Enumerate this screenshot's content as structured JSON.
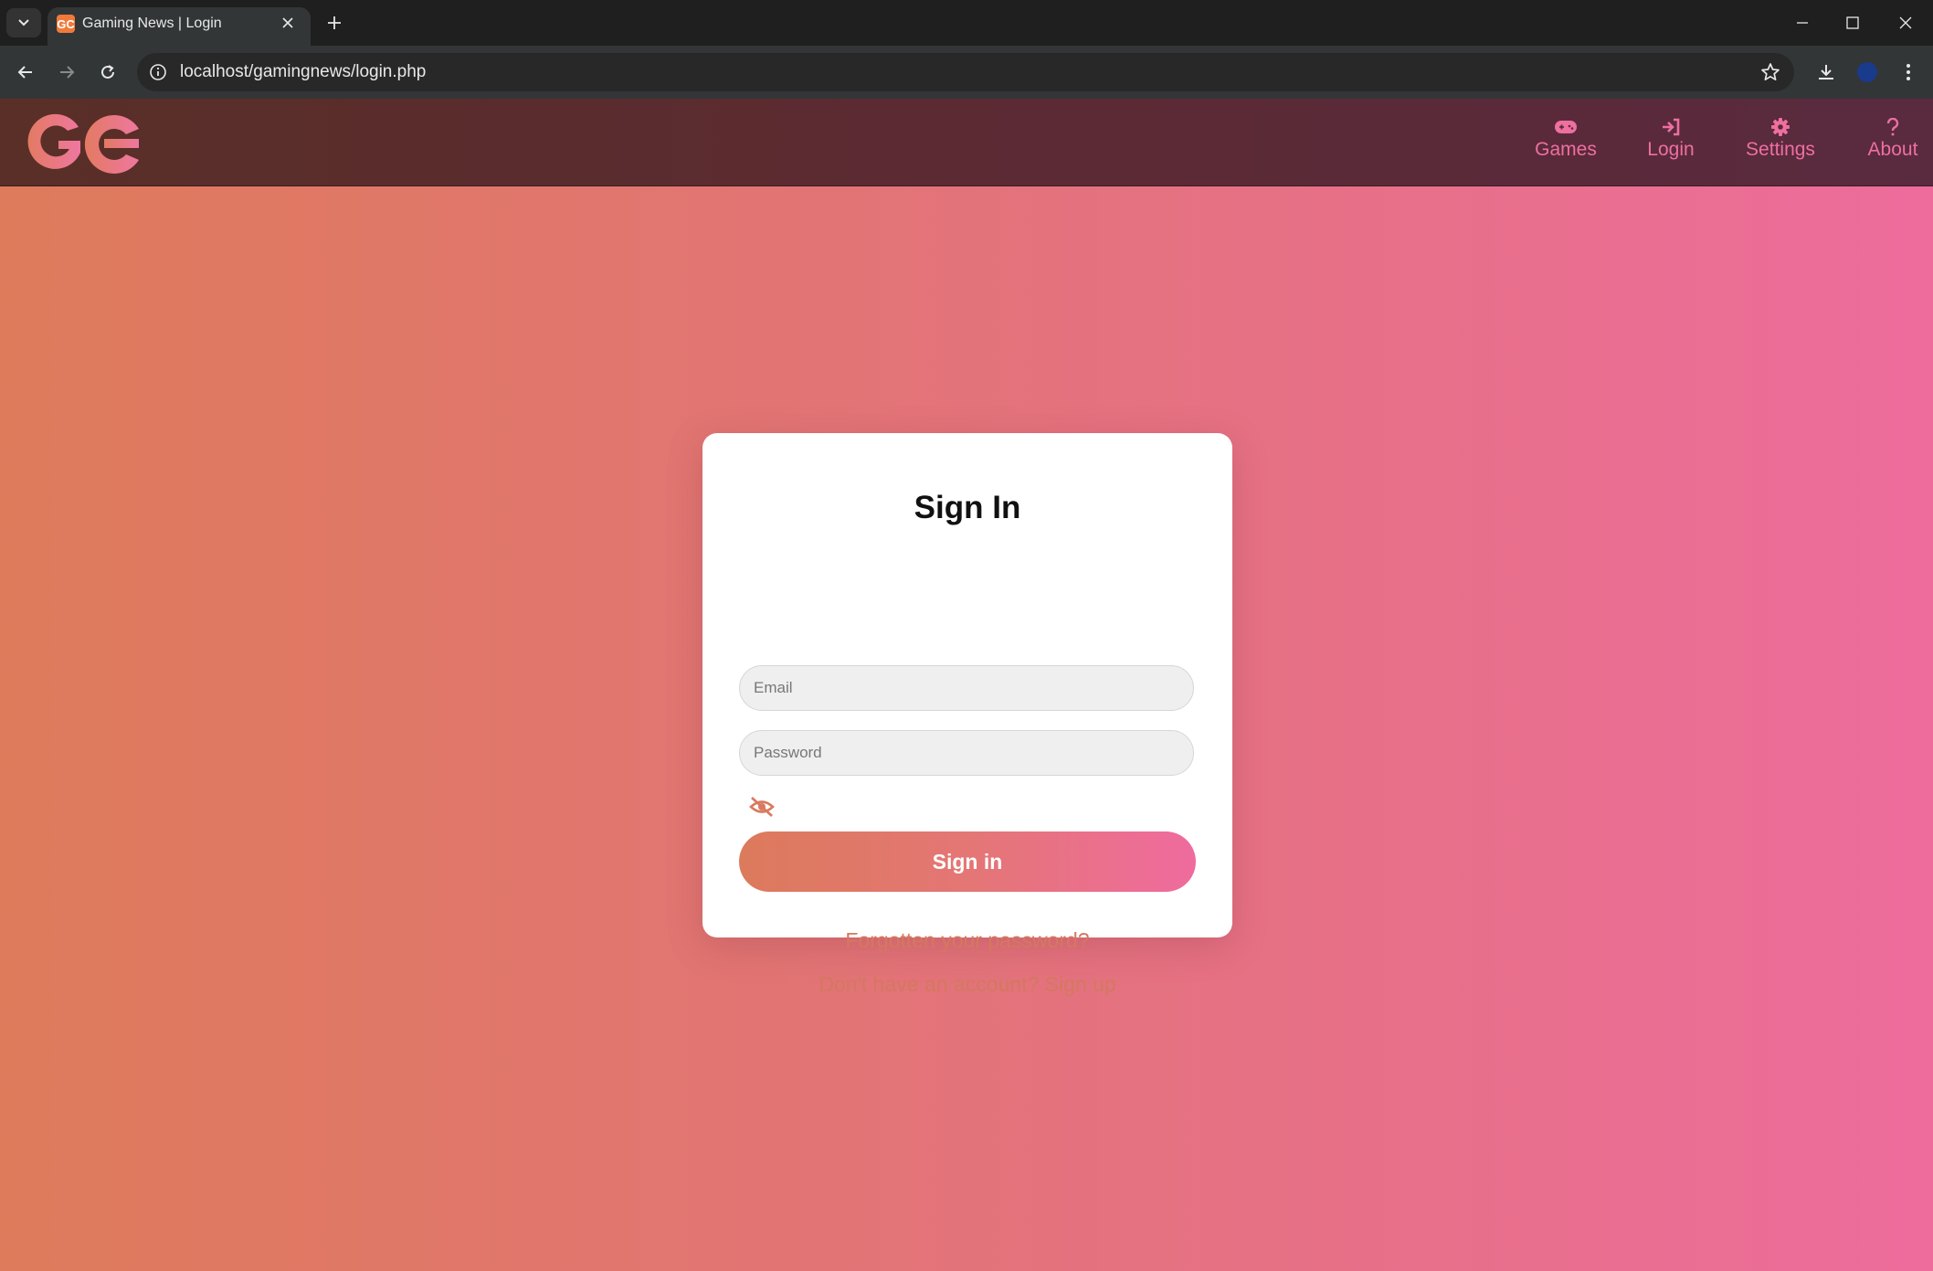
{
  "browser": {
    "tab_title": "Gaming News | Login",
    "favicon_text": "GC",
    "url": "localhost/gamingnews/login.php"
  },
  "site": {
    "logo_text": "GC",
    "nav": [
      {
        "label": "Games",
        "icon": "gamepad-icon"
      },
      {
        "label": "Login",
        "icon": "sign-in-icon"
      },
      {
        "label": "Settings",
        "icon": "gear-icon"
      },
      {
        "label": "About",
        "icon": "question-icon"
      }
    ]
  },
  "login": {
    "title": "Sign In",
    "email_placeholder": "Email",
    "password_placeholder": "Password",
    "submit_label": "Sign in",
    "forgot_link": "Forgotten your password?",
    "signup_link": "Don't have an account? Sign up"
  },
  "colors": {
    "accent_pink": "#ee6fa0",
    "accent_orange": "#de7b5b",
    "link": "#d4785f"
  }
}
